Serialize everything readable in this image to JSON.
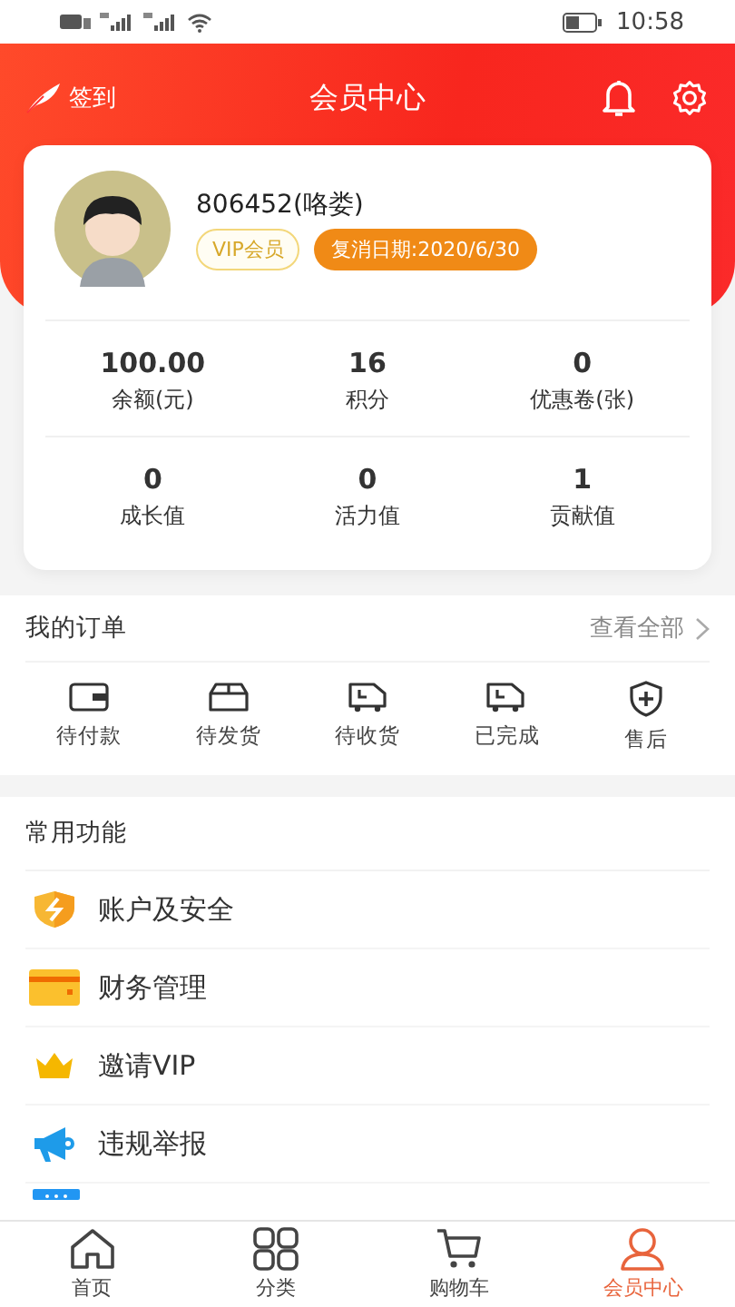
{
  "status_bar": {
    "time": "10:58"
  },
  "header": {
    "checkin": "签到",
    "title": "会员中心"
  },
  "profile": {
    "name": "806452(咯娄)",
    "level_badge": "VIP会员",
    "expiry_badge": "复消日期:2020/6/30"
  },
  "stats": [
    {
      "value": "100.00",
      "label": "余额(元)"
    },
    {
      "value": "16",
      "label": "积分"
    },
    {
      "value": "0",
      "label": "优惠卷(张)"
    },
    {
      "value": "0",
      "label": "成长值"
    },
    {
      "value": "0",
      "label": "活力值"
    },
    {
      "value": "1",
      "label": "贡献值"
    }
  ],
  "orders": {
    "title": "我的订单",
    "view_all": "查看全部",
    "items": [
      {
        "kind": "wallet",
        "label": "待付款"
      },
      {
        "kind": "box",
        "label": "待发货"
      },
      {
        "kind": "truck",
        "label": "待收货"
      },
      {
        "kind": "truck",
        "label": "已完成"
      },
      {
        "kind": "shield",
        "label": "售后"
      }
    ]
  },
  "functions": {
    "title": "常用功能",
    "items": [
      {
        "kind": "security",
        "label": "账户及安全"
      },
      {
        "kind": "card",
        "label": "财务管理"
      },
      {
        "kind": "crown",
        "label": "邀请VIP"
      },
      {
        "kind": "megaphone",
        "label": "违规举报"
      }
    ]
  },
  "tab_bar": [
    {
      "kind": "home",
      "label": "首页",
      "selected": false
    },
    {
      "kind": "grid",
      "label": "分类",
      "selected": false
    },
    {
      "kind": "cart",
      "label": "购物车",
      "selected": false
    },
    {
      "kind": "user",
      "label": "会员中心",
      "selected": true
    }
  ]
}
